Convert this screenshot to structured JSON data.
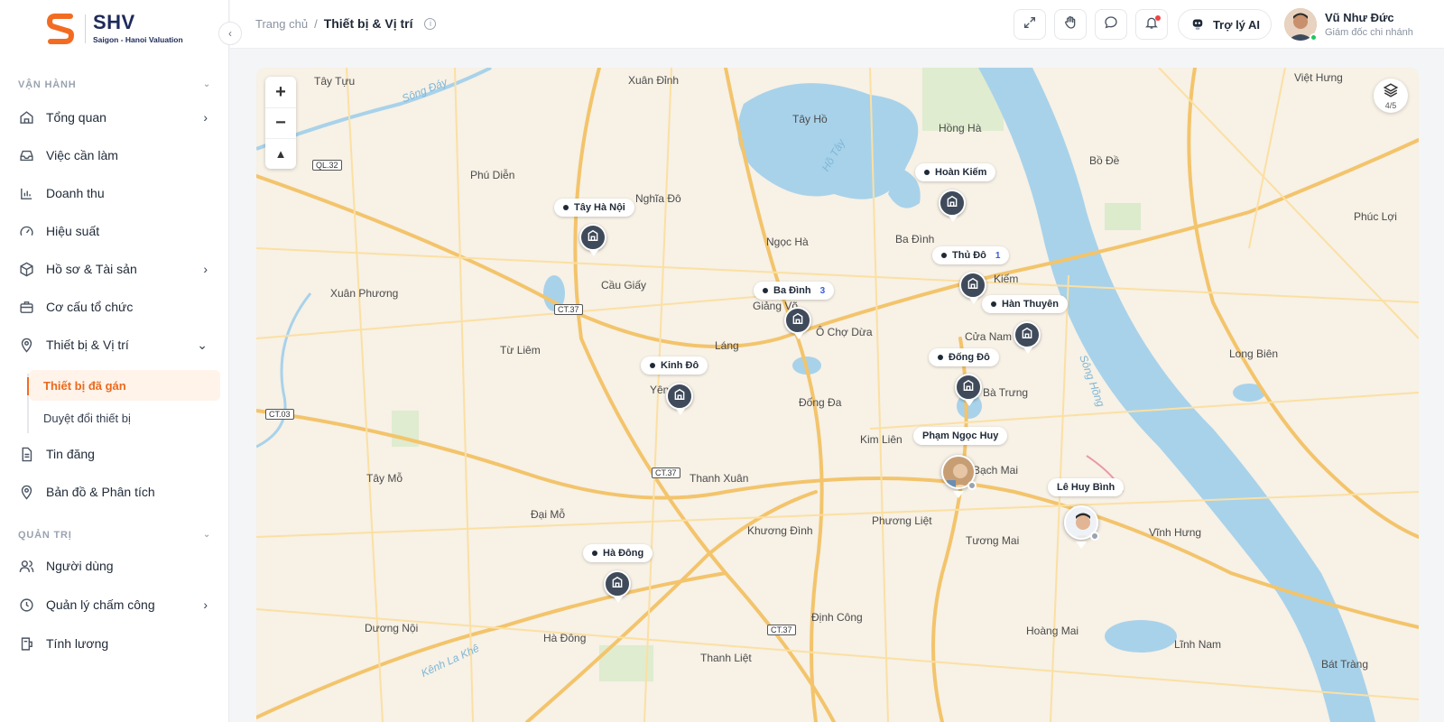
{
  "brand": {
    "name": "SHV",
    "tagline": "Saigon - Hanoi Valuation",
    "accent": "#f36b21"
  },
  "sidebar": {
    "sections": [
      {
        "label": "VẬN HÀNH"
      },
      {
        "label": "QUẢN TRỊ"
      }
    ],
    "items": [
      {
        "label": "Tổng quan",
        "icon": "home-icon",
        "has_arrow": true
      },
      {
        "label": "Việc cần làm",
        "icon": "inbox-icon"
      },
      {
        "label": "Doanh thu",
        "icon": "bar-chart-icon"
      },
      {
        "label": "Hiệu suất",
        "icon": "gauge-icon"
      },
      {
        "label": "Hồ sơ & Tài sản",
        "icon": "box-icon",
        "has_arrow": true
      },
      {
        "label": "Cơ cấu tổ chức",
        "icon": "briefcase-icon"
      },
      {
        "label": "Thiết bị & Vị trí",
        "icon": "location-pin-icon",
        "expanded": true
      },
      {
        "label": "Tin đăng",
        "icon": "document-icon"
      },
      {
        "label": "Bản đồ & Phân tích",
        "icon": "map-pin-icon"
      },
      {
        "label": "Người dùng",
        "icon": "users-icon"
      },
      {
        "label": "Quản lý chấm công",
        "icon": "clock-icon",
        "has_arrow": true
      },
      {
        "label": "Tính lương",
        "icon": "payroll-icon"
      }
    ],
    "sub_items": [
      {
        "label": "Thiết bị đã gán",
        "active": true
      },
      {
        "label": "Duyệt đổi thiết bị"
      }
    ]
  },
  "header": {
    "breadcrumb_home": "Trang chủ",
    "breadcrumb_sep": "/",
    "breadcrumb_current": "Thiết bị & Vị trí",
    "info_glyph": "i",
    "ai_label": "Trợ lý AI",
    "user_name": "Vũ Như Đức",
    "user_role": "Giám đốc chi nhánh"
  },
  "map": {
    "layers_count": "4/5",
    "places": [
      "Tây Tựu",
      "Xuân Đỉnh",
      "Tây Hồ",
      "Hồng Hà",
      "Việt Hưng",
      "Phú Diễn",
      "Nghĩa Đô",
      "Bồ Đề",
      "Phúc Lợi",
      "Ngọc Hà",
      "Ba Đình",
      "Xuân Phương",
      "Cầu Giấy",
      "Kiếm",
      "Giảng Võ",
      "Ô Chợ Dừa",
      "Cửa Nam",
      "Long Biên",
      "Từ Liêm",
      "Láng",
      "Yên",
      "Bà Trưng",
      "Đống Đa",
      "Kim Liên",
      "Bạch Mai",
      "Tây Mỗ",
      "Thanh Xuân",
      "Đại Mỗ",
      "Khương Đình",
      "Phương Liệt",
      "Tương Mai",
      "Vĩnh Hưng",
      "Định Công",
      "Dương Nội",
      "Hà Đông",
      "Thanh Liệt",
      "Hoàng Mai",
      "Lĩnh Nam",
      "Bát Tràng"
    ],
    "rivers": [
      "Sông Đáy",
      "Hồ Tây",
      "Sông Hồng",
      "Kênh La Khê"
    ],
    "roads": [
      "QL.32",
      "CT.37",
      "CT.03",
      "CT.37",
      "CT.37"
    ],
    "offices": [
      {
        "label": "Hoàn Kiếm"
      },
      {
        "label": "Tây Hà Nội"
      },
      {
        "label": "Thủ Đô",
        "badge": "1"
      },
      {
        "label": "Ba Đình",
        "badge": "3"
      },
      {
        "label": "Hàn Thuyên"
      },
      {
        "label": "Kinh Đô"
      },
      {
        "label": "Đống Đô"
      },
      {
        "label": "Hà Đông"
      }
    ],
    "staff": [
      {
        "name": "Phạm Ngọc Huy"
      },
      {
        "name": "Lê Huy Bình"
      }
    ]
  }
}
